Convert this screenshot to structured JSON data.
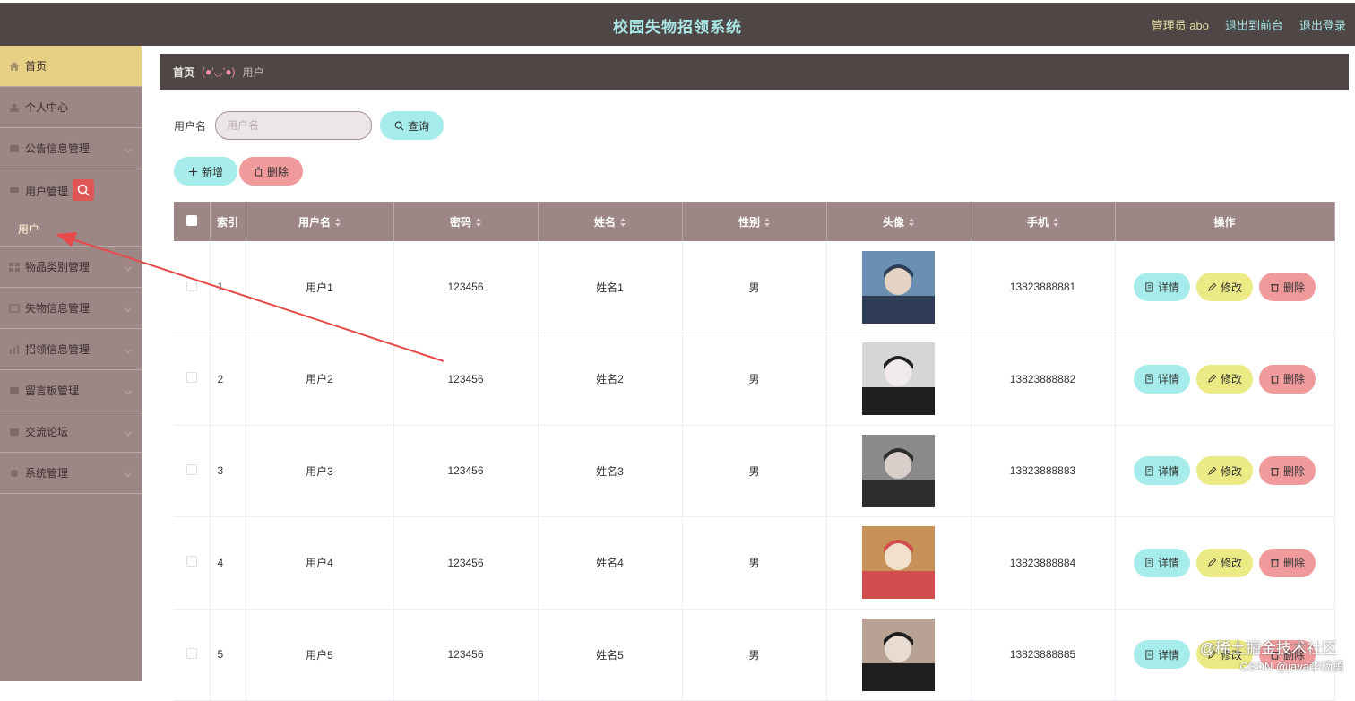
{
  "header": {
    "title": "校园失物招领系统",
    "admin": "管理员 abo",
    "to_front": "退出到前台",
    "logout": "退出登录"
  },
  "sidebar": {
    "items": [
      {
        "label": "首页",
        "icon": "home-icon"
      },
      {
        "label": "个人中心",
        "icon": "user-icon"
      },
      {
        "label": "公告信息管理",
        "icon": "notice-icon"
      },
      {
        "label": "用户管理",
        "icon": "users-icon"
      },
      {
        "label": "物品类别管理",
        "icon": "category-icon"
      },
      {
        "label": "失物信息管理",
        "icon": "lost-icon"
      },
      {
        "label": "招领信息管理",
        "icon": "claim-icon"
      },
      {
        "label": "留言板管理",
        "icon": "message-icon"
      },
      {
        "label": "交流论坛",
        "icon": "forum-icon"
      },
      {
        "label": "系统管理",
        "icon": "system-icon"
      }
    ],
    "sub_item": "用户"
  },
  "breadcrumb": {
    "home": "首页",
    "separator": "(●'◡'●)",
    "current": "用户"
  },
  "search": {
    "label": "用户名",
    "placeholder": "用户名",
    "button": "查询"
  },
  "actions": {
    "add": "新增",
    "delete": "删除"
  },
  "table": {
    "columns": [
      "索引",
      "用户名",
      "密码",
      "姓名",
      "性别",
      "头像",
      "手机",
      "操作"
    ],
    "rows": [
      {
        "index": "1",
        "username": "用户1",
        "password": "123456",
        "name": "姓名1",
        "gender": "男",
        "phone": "13823888881"
      },
      {
        "index": "2",
        "username": "用户2",
        "password": "123456",
        "name": "姓名2",
        "gender": "男",
        "phone": "13823888882"
      },
      {
        "index": "3",
        "username": "用户3",
        "password": "123456",
        "name": "姓名3",
        "gender": "男",
        "phone": "13823888883"
      },
      {
        "index": "4",
        "username": "用户4",
        "password": "123456",
        "name": "姓名4",
        "gender": "男",
        "phone": "13823888884"
      },
      {
        "index": "5",
        "username": "用户5",
        "password": "123456",
        "name": "姓名5",
        "gender": "男",
        "phone": "13823888885"
      }
    ],
    "row_actions": {
      "detail": "详情",
      "edit": "修改",
      "delete": "删除"
    }
  },
  "watermark": {
    "line1": "@稀土掘金技术社区",
    "line2": "CSDN @java李杨勇"
  },
  "colors": {
    "topbar": "#4f4746",
    "sidebar": "#9c8786",
    "active_menu": "#e7cf84",
    "cyan_button": "#a5ecea",
    "yellow_button": "#ecea84",
    "red_button": "#f19a9c",
    "title": "#a7e8e6"
  }
}
